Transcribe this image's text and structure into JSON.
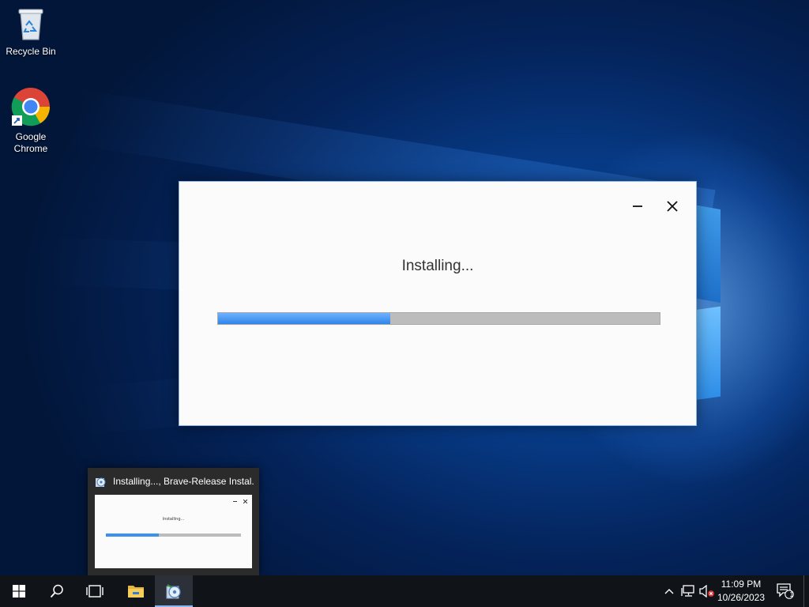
{
  "desktop": {
    "icons": [
      {
        "label": "Recycle Bin",
        "icon": "recycle-bin-icon"
      },
      {
        "label": "Google Chrome",
        "label_line1": "Google",
        "label_line2": "Chrome",
        "icon": "chrome-icon"
      }
    ]
  },
  "installer_window": {
    "status_text": "Installing...",
    "progress_fraction": 0.39,
    "minimize_icon": "minimize-icon",
    "close_icon": "close-icon",
    "accent_color": "#3b8cf0"
  },
  "taskbar_preview": {
    "title": "Installing..., Brave-Release Instal...",
    "thumbnail_text": "Installing..."
  },
  "taskbar": {
    "buttons": [
      {
        "name": "start",
        "icon": "windows-start-icon"
      },
      {
        "name": "search",
        "icon": "search-icon"
      },
      {
        "name": "task-view",
        "icon": "task-view-icon"
      },
      {
        "name": "file-explorer",
        "icon": "folder-icon"
      },
      {
        "name": "brave-installer",
        "icon": "installer-icon",
        "active": true
      }
    ],
    "tray": {
      "icons": [
        "chevron-up-icon",
        "network-icon",
        "volume-muted-icon"
      ],
      "time": "11:09 PM",
      "date": "10/26/2023",
      "notification_count": "1"
    }
  }
}
